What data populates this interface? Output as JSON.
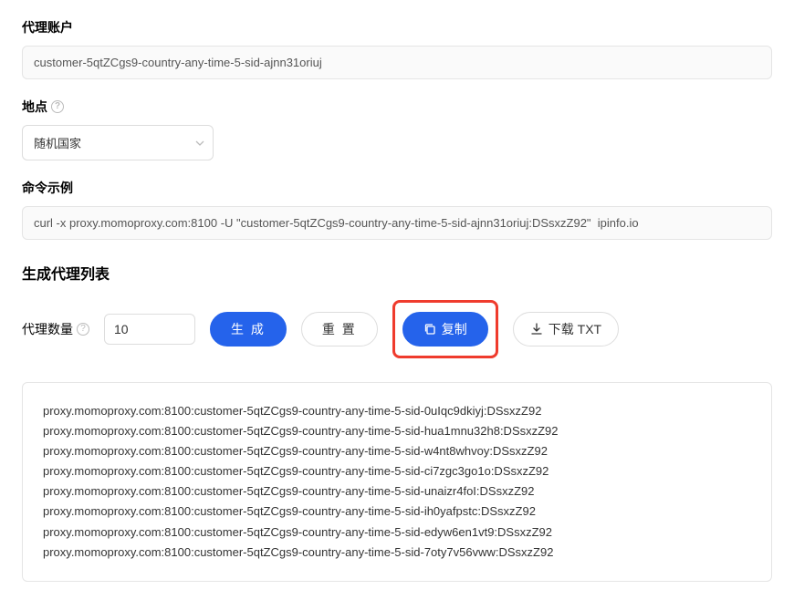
{
  "proxy_account": {
    "label": "代理账户",
    "value": "customer-5qtZCgs9-country-any-time-5-sid-ajnn31oriuj"
  },
  "location": {
    "label": "地点",
    "selected": "随机国家"
  },
  "command_example": {
    "label": "命令示例",
    "value": "curl -x proxy.momoproxy.com:8100 -U \"customer-5qtZCgs9-country-any-time-5-sid-ajnn31oriuj:DSsxzZ92\"  ipinfo.io"
  },
  "proxy_list": {
    "title": "生成代理列表",
    "qty_label": "代理数量",
    "qty_value": "10",
    "generate_label": "生 成",
    "reset_label": "重 置",
    "copy_label": "复制",
    "download_label": "下载 TXT",
    "items": [
      "proxy.momoproxy.com:8100:customer-5qtZCgs9-country-any-time-5-sid-0uIqc9dkiyj:DSsxzZ92",
      "proxy.momoproxy.com:8100:customer-5qtZCgs9-country-any-time-5-sid-hua1mnu32h8:DSsxzZ92",
      "proxy.momoproxy.com:8100:customer-5qtZCgs9-country-any-time-5-sid-w4nt8whvoy:DSsxzZ92",
      "proxy.momoproxy.com:8100:customer-5qtZCgs9-country-any-time-5-sid-ci7zgc3go1o:DSsxzZ92",
      "proxy.momoproxy.com:8100:customer-5qtZCgs9-country-any-time-5-sid-unaizr4foI:DSsxzZ92",
      "proxy.momoproxy.com:8100:customer-5qtZCgs9-country-any-time-5-sid-ih0yafpstc:DSsxzZ92",
      "proxy.momoproxy.com:8100:customer-5qtZCgs9-country-any-time-5-sid-edyw6en1vt9:DSsxzZ92",
      "proxy.momoproxy.com:8100:customer-5qtZCgs9-country-any-time-5-sid-7oty7v56vww:DSsxzZ92"
    ]
  }
}
